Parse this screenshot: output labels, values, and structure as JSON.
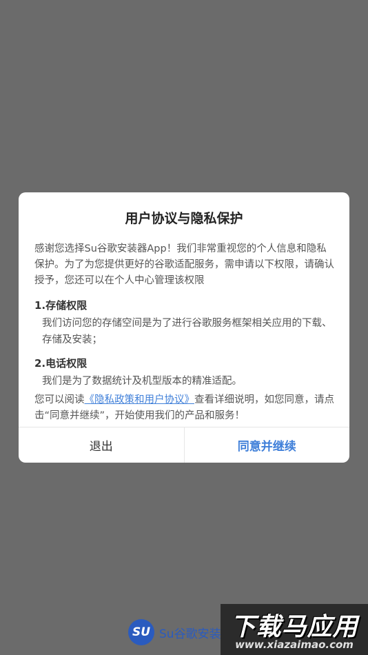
{
  "dialog": {
    "title": "用户协议与隐私保护",
    "intro": "感谢您选择Su谷歌安装器App！我们非常重视您的个人信息和隐私保护。为了为您提供更好的谷歌适配服务，需申请以下权限，请确认授予，您还可以在个人中心管理该权限",
    "permissions": [
      {
        "title": "1.存储权限",
        "desc": "我们访问您的存储空间是为了进行谷歌服务框架相关应用的下载、存储及安装；"
      },
      {
        "title": "2.电话权限",
        "desc": "我们是为了数据统计及机型版本的精准适配。"
      }
    ],
    "footer": {
      "prefix": "您可以阅读",
      "link": "《隐私政策和用户协议》",
      "suffix": "查看详细说明，如您同意，请点击“同意并继续”，开始使用我们的产品和服务！"
    },
    "buttons": {
      "exit": "退出",
      "agree": "同意并继续"
    }
  },
  "brand": {
    "logo": "SU",
    "name": "Su谷歌安装"
  },
  "watermark": {
    "main": "下载马应用",
    "url": "www.xiazaimao.com"
  },
  "colors": {
    "overlay": "#6b6b6b",
    "accent": "#3f7fd9",
    "brand": "#2a5bbf"
  }
}
